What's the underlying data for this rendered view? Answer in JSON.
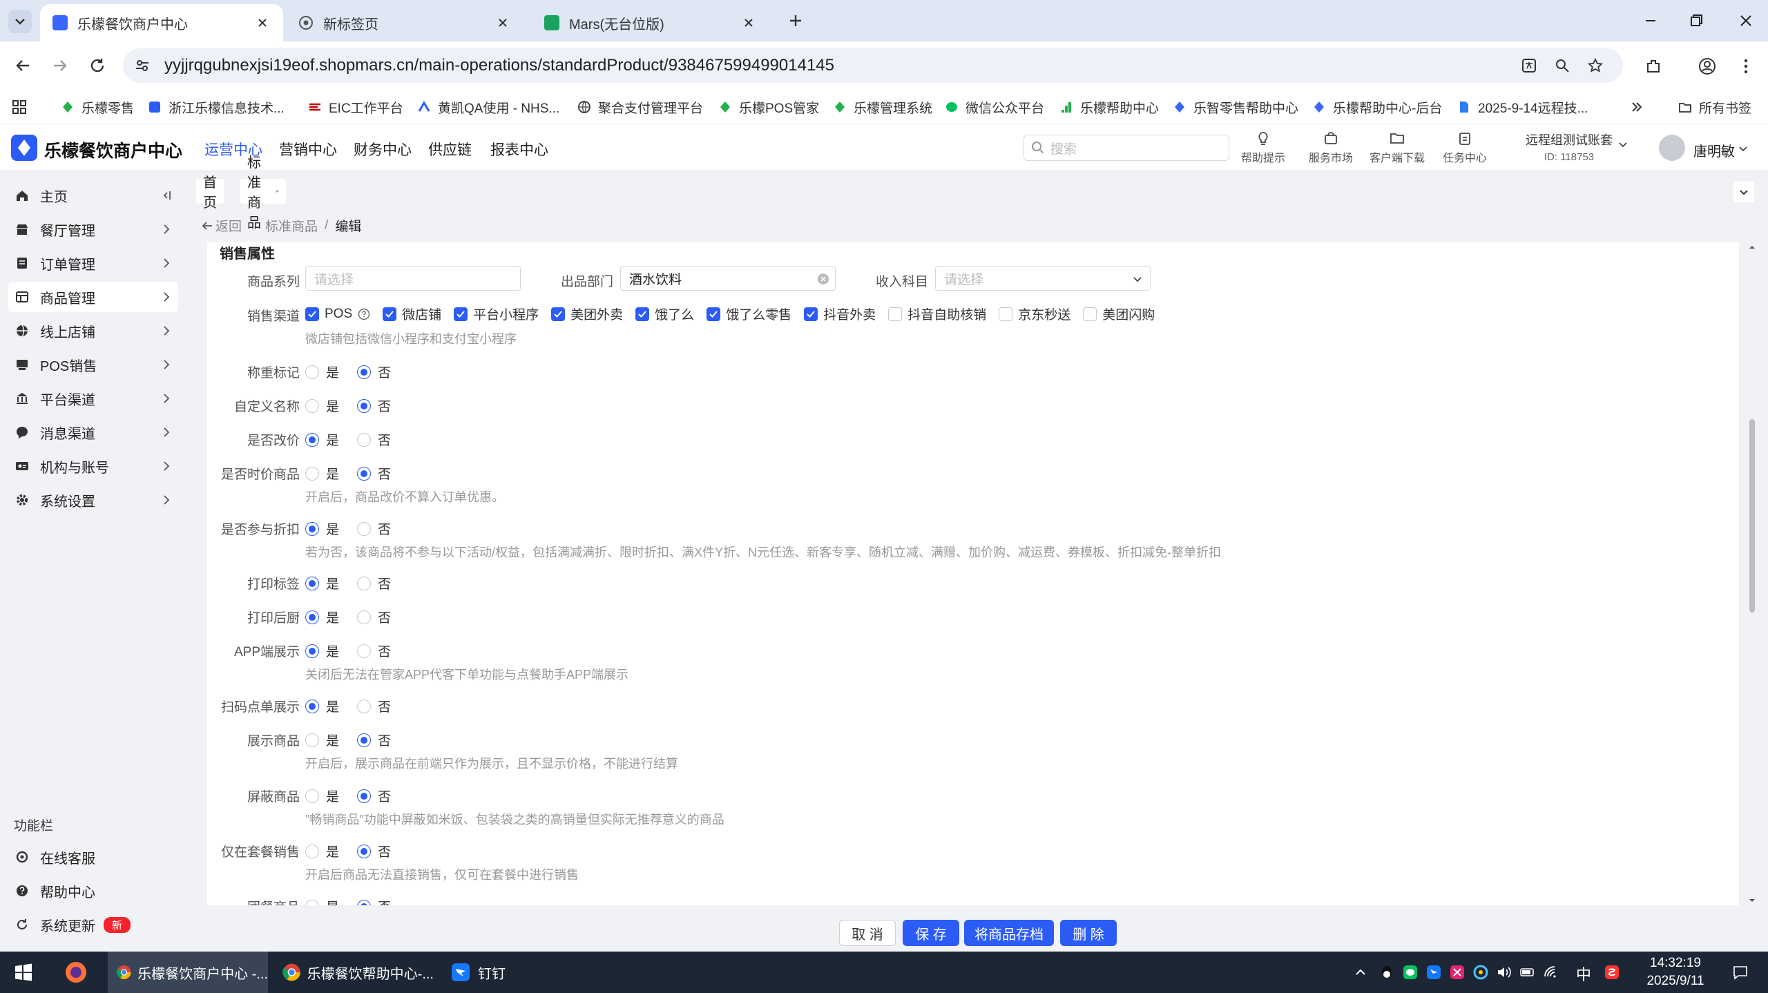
{
  "browser": {
    "tabs": [
      {
        "title": "乐檬餐饮商户中心",
        "active": true
      },
      {
        "title": "新标签页",
        "active": false
      },
      {
        "title": "Mars(无台位版)",
        "active": false
      }
    ],
    "url": "yyjjrqgubnexjsi19eof.shopmars.cn/main-operations/standardProduct/938467599499014145",
    "bookmarks": [
      "乐檬零售",
      "浙江乐檬信息技术...",
      "EIC工作平台",
      "黄凯QA使用 - NHS...",
      "聚合支付管理平台",
      "乐檬POS管家",
      "乐檬管理系统",
      "微信公众平台",
      "乐檬帮助中心",
      "乐智零售帮助中心",
      "乐檬帮助中心-后台",
      "2025-9-14远程技..."
    ],
    "all_bookmarks": "所有书签"
  },
  "app": {
    "title": "乐檬餐饮商户中心",
    "nav": [
      "运营中心",
      "营销中心",
      "财务中心",
      "供应链",
      "报表中心"
    ],
    "search_placeholder": "搜索",
    "tools": [
      "帮助提示",
      "服务市场",
      "客户端下载",
      "任务中心"
    ],
    "account_name": "远程组测试账套",
    "account_id": "ID: 118753",
    "user": "唐明敏"
  },
  "sidebar": {
    "items": [
      "主页",
      "餐厅管理",
      "订单管理",
      "商品管理",
      "线上店铺",
      "POS销售",
      "平台渠道",
      "消息渠道",
      "机构与账号",
      "系统设置"
    ],
    "section_title": "功能栏",
    "bottom_items": [
      "在线客服",
      "帮助中心",
      "系统更新"
    ],
    "new_badge": "新"
  },
  "page_tabs": [
    "首页",
    "标准商品"
  ],
  "breadcrumb": {
    "back": "返回",
    "parent": "标准商品",
    "separator": "/",
    "current": "编辑"
  },
  "form": {
    "section_title": "销售属性",
    "series_label": "商品系列",
    "series_placeholder": "请选择",
    "dept_label": "出品部门",
    "dept_value": "酒水饮料",
    "income_label": "收入科目",
    "income_placeholder": "请选择",
    "channel_label": "销售渠道",
    "channels": [
      {
        "name": "POS",
        "checked": true
      },
      {
        "name": "微店铺",
        "checked": true
      },
      {
        "name": "平台小程序",
        "checked": true
      },
      {
        "name": "美团外卖",
        "checked": true
      },
      {
        "name": "饿了么",
        "checked": true
      },
      {
        "name": "饿了么零售",
        "checked": true
      },
      {
        "name": "抖音外卖",
        "checked": true
      },
      {
        "name": "抖音自助核销",
        "checked": false
      },
      {
        "name": "京东秒送",
        "checked": false
      },
      {
        "name": "美团闪购",
        "checked": false
      }
    ],
    "channel_hint": "微店铺包括微信小程序和支付宝小程序",
    "yes": "是",
    "no": "否",
    "rows": [
      {
        "label": "称重标记",
        "value": "否",
        "hint": ""
      },
      {
        "label": "自定义名称",
        "value": "否",
        "hint": ""
      },
      {
        "label": "是否改价",
        "value": "是",
        "hint": ""
      },
      {
        "label": "是否时价商品",
        "value": "否",
        "hint": "开启后，商品改价不算入订单优惠。"
      },
      {
        "label": "是否参与折扣",
        "value": "是",
        "hint": "若为否，该商品将不参与以下活动/权益，包括满减满折、限时折扣、满X件Y折、N元任选、新客专享、随机立减、满赠、加价购、减运费、券模板、折扣减免-整单折扣"
      },
      {
        "label": "打印标签",
        "value": "是",
        "hint": ""
      },
      {
        "label": "打印后厨",
        "value": "是",
        "hint": ""
      },
      {
        "label": "APP端展示",
        "value": "是",
        "hint": "关闭后无法在管家APP代客下单功能与点餐助手APP端展示"
      },
      {
        "label": "扫码点单展示",
        "value": "是",
        "hint": ""
      },
      {
        "label": "展示商品",
        "value": "否",
        "hint": "开启后，展示商品在前端只作为展示，且不显示价格，不能进行结算"
      },
      {
        "label": "屏蔽商品",
        "value": "否",
        "hint": "\"畅销商品\"功能中屏蔽如米饭、包装袋之类的高销量但实际无推荐意义的商品"
      },
      {
        "label": "仅在套餐销售",
        "value": "否",
        "hint": "开启后商品无法直接销售，仅可在套餐中进行销售"
      },
      {
        "label": "团餐商品",
        "value": "否",
        "hint": ""
      }
    ]
  },
  "buttons": {
    "cancel": "取 消",
    "save": "保 存",
    "archive": "将商品存档",
    "delete": "删 除"
  },
  "taskbar": {
    "apps": [
      "乐檬餐饮商户中心 -...",
      "乐檬餐饮帮助中心-...",
      "钉钉"
    ],
    "ime": "中",
    "time": "14:32:19",
    "date": "2025/9/11"
  },
  "colors": {
    "accent": "#2b5cf5",
    "sidebar_bg": "#f0f2f5",
    "taskbar_bg": "#1c2635",
    "badge": "#f5222d"
  }
}
